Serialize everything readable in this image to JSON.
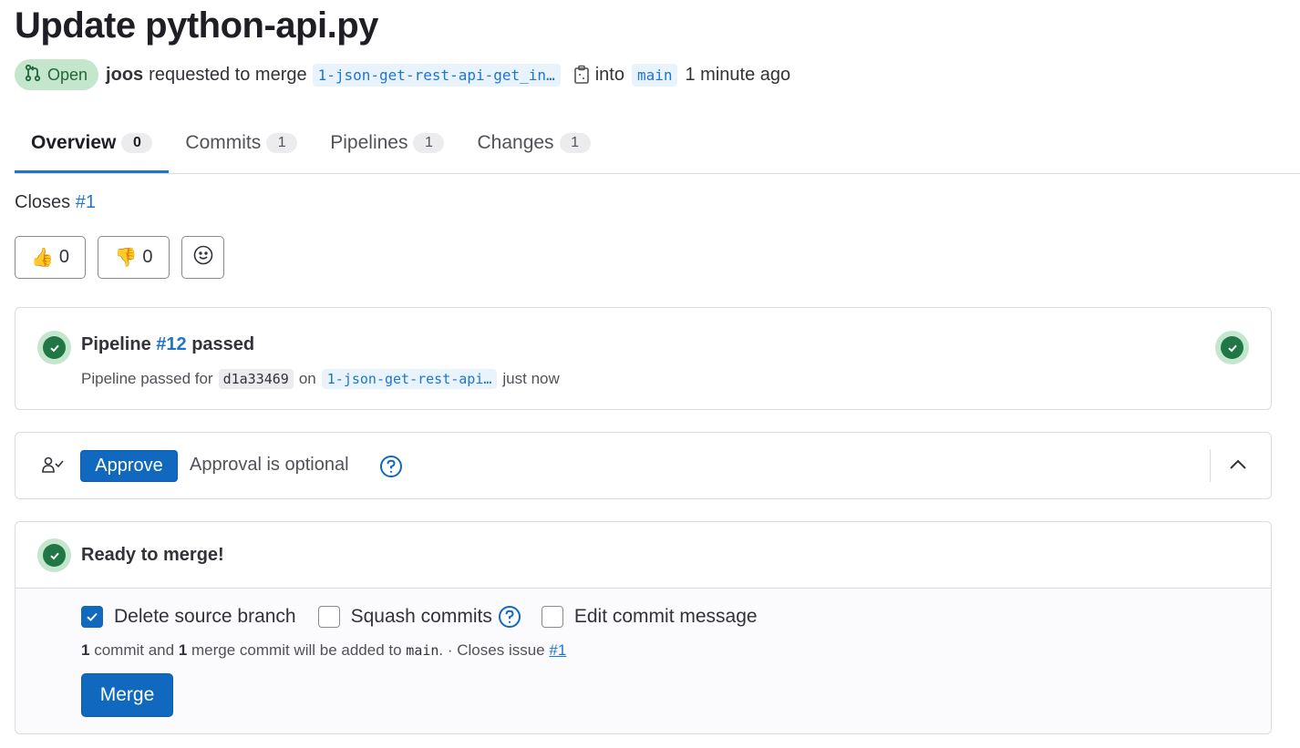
{
  "mr": {
    "title": "Update python-api.py",
    "status": "Open",
    "author": "joos",
    "requested_text": "requested to merge",
    "source_branch": "1-json-get-rest-api-get_in…",
    "into_text": "into",
    "target_branch": "main",
    "time_ago": "1 minute ago"
  },
  "tabs": [
    {
      "label": "Overview",
      "count": "0",
      "active": true
    },
    {
      "label": "Commits",
      "count": "1",
      "active": false
    },
    {
      "label": "Pipelines",
      "count": "1",
      "active": false
    },
    {
      "label": "Changes",
      "count": "1",
      "active": false
    }
  ],
  "closes": {
    "label": "Closes",
    "issue": "#1"
  },
  "reactions": {
    "thumbs_up_count": "0",
    "thumbs_down_count": "0",
    "thumbs_up_emoji": "👍",
    "thumbs_down_emoji": "👎"
  },
  "pipeline": {
    "title_prefix": "Pipeline",
    "id": "#12",
    "status_word": "passed",
    "sub_prefix": "Pipeline passed for",
    "sha": "d1a33469",
    "on_text": "on",
    "branch": "1-json-get-rest-api…",
    "time": "just now"
  },
  "approval": {
    "button_label": "Approve",
    "text": "Approval is optional"
  },
  "merge": {
    "title": "Ready to merge!",
    "options": {
      "delete_source": "Delete source branch",
      "delete_source_checked": true,
      "squash": "Squash commits",
      "squash_checked": false,
      "edit_message": "Edit commit message",
      "edit_message_checked": false
    },
    "info": {
      "commit_count": "1",
      "commit_text": "commit and",
      "merge_count": "1",
      "merge_text": "merge commit will be added to",
      "branch": "main",
      "closes_text": ". · Closes issue",
      "issue": "#1"
    },
    "button_label": "Merge"
  },
  "colors": {
    "accent": "#1f75cb",
    "primary_button": "#1068bf",
    "success": "#217645",
    "success_bg": "#c3e6cd"
  }
}
